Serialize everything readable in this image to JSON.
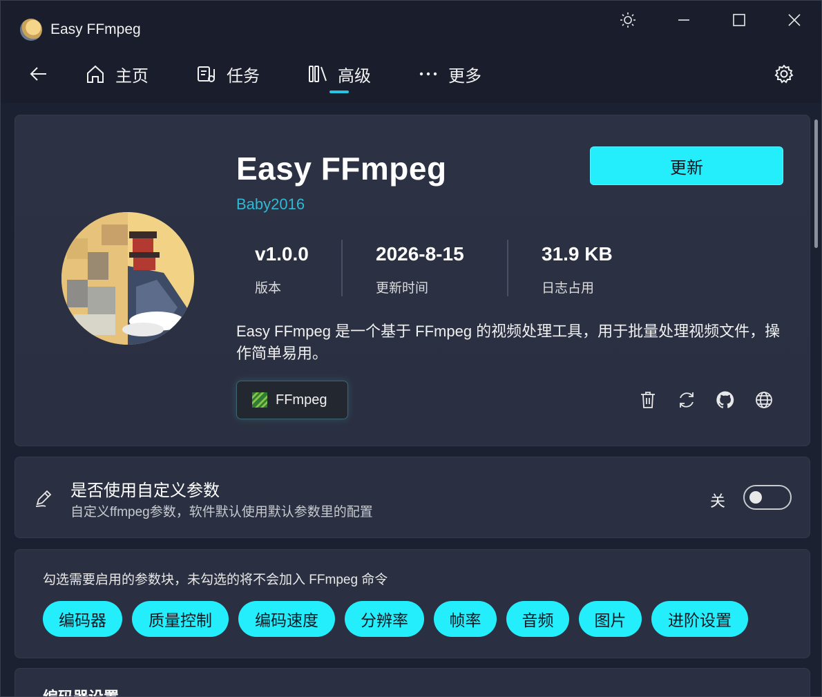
{
  "app": {
    "title": "Easy FFmpeg"
  },
  "nav": {
    "items": [
      {
        "label": "主页",
        "icon": "home-icon"
      },
      {
        "label": "任务",
        "icon": "task-icon"
      },
      {
        "label": "高级",
        "icon": "library-icon",
        "selected": true
      },
      {
        "label": "更多",
        "icon": "more-icon"
      }
    ]
  },
  "hero": {
    "title": "Easy FFmpeg",
    "author": "Baby2016",
    "update_label": "更新",
    "stats": [
      {
        "value": "v1.0.0",
        "label": "版本"
      },
      {
        "value": "2026-8-15",
        "label": "更新时间"
      },
      {
        "value": "31.9 KB",
        "label": "日志占用"
      }
    ],
    "description": "Easy FFmpeg 是一个基于 FFmpeg 的视频处理工具，用于批量处理视频文件，操作简单易用。",
    "tag": "FFmpeg"
  },
  "custom_params": {
    "title": "是否使用自定义参数",
    "description": "自定义ffmpeg参数，软件默认使用默认参数里的配置",
    "toggle_label": "关",
    "enabled": false
  },
  "param_blocks": {
    "hint": "勾选需要启用的参数块，未勾选的将不会加入 FFmpeg 命令",
    "chips": [
      "编码器",
      "质量控制",
      "编码速度",
      "分辨率",
      "帧率",
      "音频",
      "图片",
      "进阶设置"
    ]
  },
  "next_section": {
    "title": "编码器设置"
  },
  "colors": {
    "accent": "#24eefc",
    "author": "#2fb9d4",
    "background": "#1c2131",
    "card": "#2a3041"
  }
}
